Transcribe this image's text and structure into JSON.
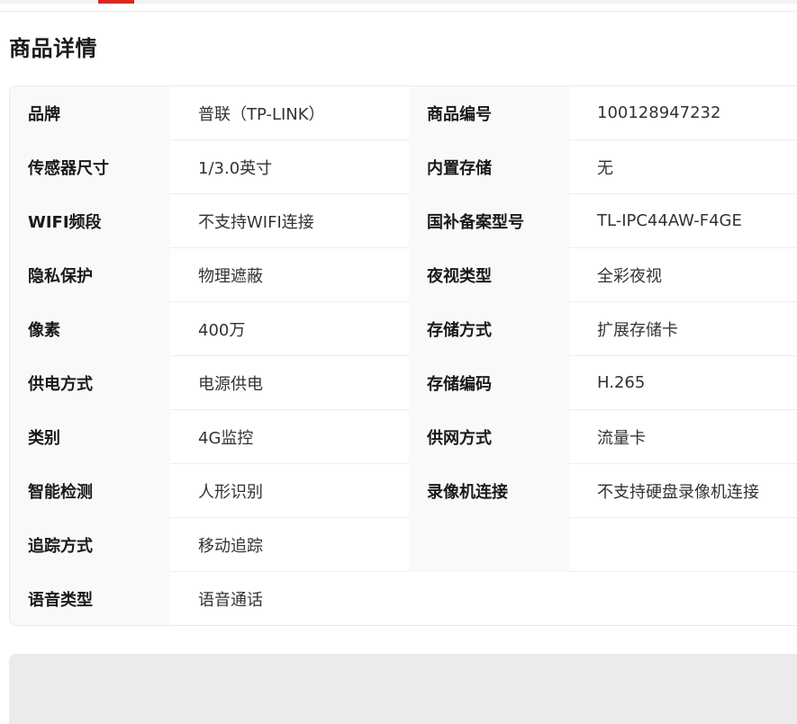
{
  "header": {
    "title": "商品详情"
  },
  "specs": {
    "rows": [
      {
        "left": {
          "label": "品牌",
          "value": "普联（TP-LINK）"
        },
        "right": {
          "label": "商品编号",
          "value": "100128947232"
        }
      },
      {
        "left": {
          "label": "传感器尺寸",
          "value": "1/3.0英寸"
        },
        "right": {
          "label": "内置存储",
          "value": "无"
        }
      },
      {
        "left": {
          "label": "WIFI频段",
          "value": "不支持WIFI连接"
        },
        "right": {
          "label": "国补备案型号",
          "value": "TL-IPC44AW-F4GE"
        }
      },
      {
        "left": {
          "label": "隐私保护",
          "value": "物理遮蔽"
        },
        "right": {
          "label": "夜视类型",
          "value": "全彩夜视"
        }
      },
      {
        "left": {
          "label": "像素",
          "value": "400万"
        },
        "right": {
          "label": "存储方式",
          "value": "扩展存储卡"
        }
      },
      {
        "left": {
          "label": "供电方式",
          "value": "电源供电"
        },
        "right": {
          "label": "存储编码",
          "value": "H.265"
        }
      },
      {
        "left": {
          "label": "类别",
          "value": "4G监控"
        },
        "right": {
          "label": "供网方式",
          "value": "流量卡"
        }
      },
      {
        "left": {
          "label": "智能检测",
          "value": "人形识别"
        },
        "right": {
          "label": "录像机连接",
          "value": "不支持硬盘录像机连接"
        }
      },
      {
        "left": {
          "label": "追踪方式",
          "value": "移动追踪"
        },
        "right": {
          "label": "",
          "value": ""
        }
      },
      {
        "left": {
          "label": "语音类型",
          "value": "语音通话"
        }
      }
    ]
  },
  "colors": {
    "accent": "#e1251b",
    "label_bg": "#f8f9fb",
    "border": "#eaeaea",
    "panel_bg": "#ebebeb"
  }
}
